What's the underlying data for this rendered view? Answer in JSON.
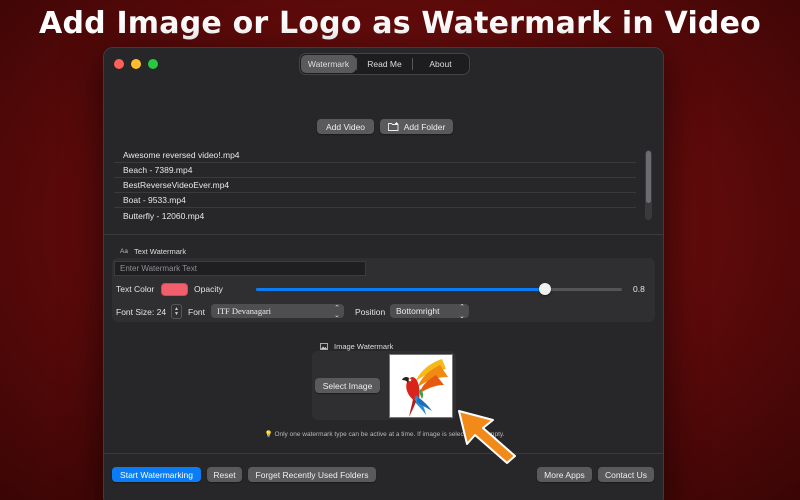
{
  "headline": "Add Image or Logo as Watermark in Video",
  "tabs": [
    {
      "label": "Watermark"
    },
    {
      "label": "Read Me"
    },
    {
      "label": "About"
    }
  ],
  "toolbar": {
    "add_video": "Add Video",
    "add_folder": "Add Folder"
  },
  "files": [
    {
      "name": "Awesome reversed video!.mp4"
    },
    {
      "name": "Beach - 7389.mp4"
    },
    {
      "name": "BestReverseVideoEver.mp4"
    },
    {
      "name": "Boat - 9533.mp4"
    },
    {
      "name": "Butterfly - 12060.mp4"
    }
  ],
  "text_watermark": {
    "icon": "Aa",
    "title": "Text Watermark",
    "placeholder": "Enter Watermark Text",
    "text_color_label": "Text Color",
    "text_color": "#f25e6b",
    "opacity_label": "Opacity",
    "opacity": 0.8,
    "opacity_display": "0.8",
    "font_size_label": "Font Size: 24",
    "font_label": "Font",
    "font_value": "ITF Devanagari",
    "position_label": "Position",
    "position_value": "Bottomright"
  },
  "image_watermark": {
    "title": "Image Watermark",
    "select_label": "Select Image"
  },
  "note": "Only one watermark type can be active at a time. If image is selected, t          e empty.",
  "footer": {
    "start": "Start Watermarking",
    "reset": "Reset",
    "forget": "Forget Recently Used Folders",
    "more_apps": "More Apps",
    "contact": "Contact Us"
  },
  "colors": {
    "accent": "#0a7cf5",
    "arrow": "#f28a1a"
  }
}
